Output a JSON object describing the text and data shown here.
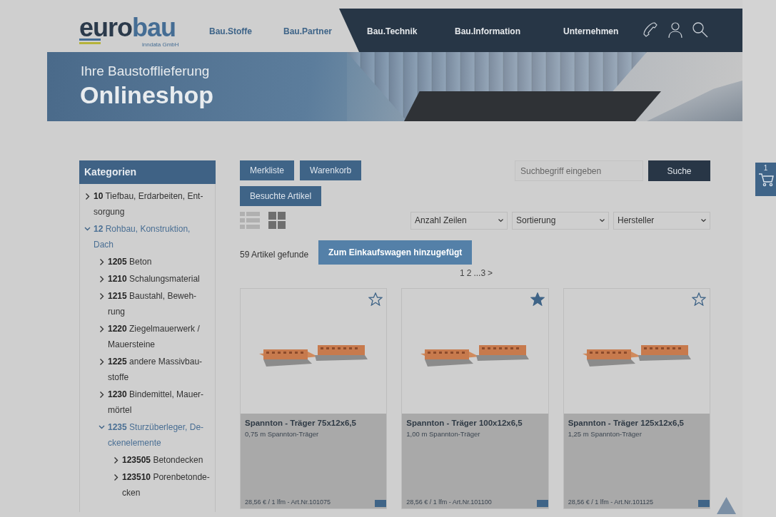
{
  "header": {
    "logo": {
      "word_dark": "euro",
      "word_light": "bau",
      "sub": "inndata GmbH"
    },
    "nav": [
      {
        "label": "Bau.Stoffe",
        "selected": false
      },
      {
        "label": "Bau.Partner",
        "selected": false
      },
      {
        "label": "Bau.Technik",
        "selected": false
      },
      {
        "label": "Bau.Information",
        "selected": false
      },
      {
        "label": "Unternehmen",
        "selected": false
      }
    ]
  },
  "banner": {
    "subtitle": "Ihre Baustofflieferung",
    "title": "Onlineshop"
  },
  "sidebar": {
    "title": "Kategorien",
    "items": [
      {
        "code": "10",
        "name": "Tiefbau, Erdarbeiten, Ent-sorgung",
        "expanded": false
      },
      {
        "code": "12",
        "name": "Rohbau, Konstruktion, Dach",
        "expanded": true,
        "children": [
          {
            "code": "1205",
            "name": "Beton",
            "expanded": false
          },
          {
            "code": "1210",
            "name": "Schalungsmaterial",
            "expanded": false
          },
          {
            "code": "1215",
            "name": "Baustahl, Beweh-rung",
            "expanded": false
          },
          {
            "code": "1220",
            "name": "Ziegelmauerwerk / Mauersteine",
            "expanded": false
          },
          {
            "code": "1225",
            "name": "andere Massivbau-stoffe",
            "expanded": false
          },
          {
            "code": "1230",
            "name": "Bindemittel, Mauer-mörtel",
            "expanded": false
          },
          {
            "code": "1235",
            "name": "Sturzüberleger, De-ckenelemente",
            "expanded": true,
            "children": [
              {
                "code": "123505",
                "name": "Betondecken",
                "expanded": false
              },
              {
                "code": "123510",
                "name": "Porenbetonde-cken",
                "expanded": false
              }
            ]
          }
        ]
      }
    ]
  },
  "toolbar": {
    "buttons": [
      "Merkliste",
      "Warenkorb",
      "Besuchte Artikel"
    ],
    "search": {
      "placeholder": "Suchbegriff eingeben",
      "button": "Suche"
    },
    "view_modes": [
      {
        "kind": "list",
        "selected": false
      },
      {
        "kind": "grid",
        "selected": true
      }
    ],
    "selects": [
      "Anzahl Zeilen",
      "Sortierung",
      "Hersteller"
    ]
  },
  "result_count": "59 Artikel gefunde",
  "toast": "Zum Einkaufswagen hinzugefügt",
  "pagination": [
    "1",
    "2",
    "...3",
    ">"
  ],
  "products": [
    {
      "title": "Spannton - Träger 75x12x6,5",
      "subtitle": "0,75 m Spannton-Träger",
      "footer": "28,56 € / 1 lfm - Art.Nr.101075",
      "favorite": false
    },
    {
      "title": "Spannton - Träger 100x12x6,5",
      "subtitle": "1,00 m Spannton-Träger",
      "footer": "28,56 € / 1 lfm - Art.Nr.101100",
      "favorite": true
    },
    {
      "title": "Spannton - Träger 125x12x6,5",
      "subtitle": "1,25 m Spannton-Träger",
      "footer": "28,56 € / 1 lfm - Art.Nr.101125",
      "favorite": false
    }
  ],
  "cart_tab": {
    "count": "1"
  }
}
